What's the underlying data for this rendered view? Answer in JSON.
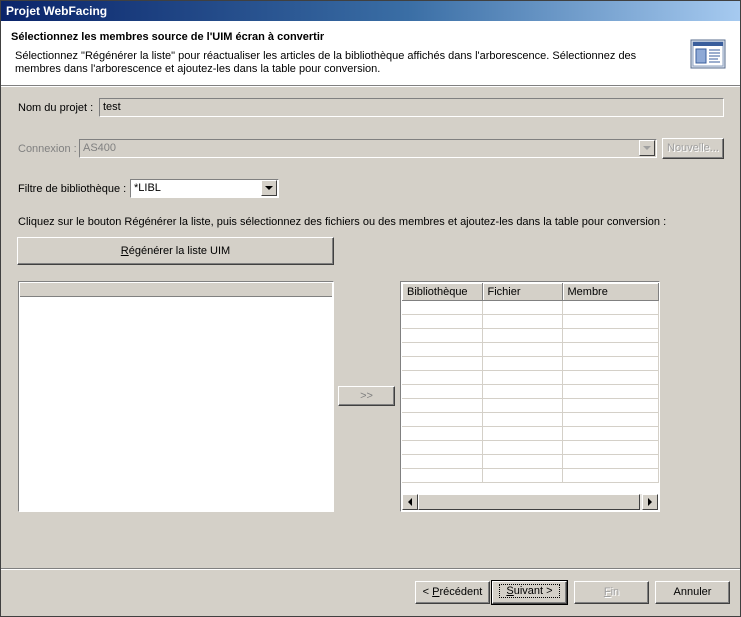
{
  "window": {
    "title": "Projet WebFacing"
  },
  "header": {
    "title": "Sélectionnez les membres source de l'UIM écran à convertir",
    "description": "Sélectionnez \"Régénérer la liste\" pour réactualiser les articles de la bibliothèque affichés dans l'arborescence. Sélectionnez des membres dans l'arborescence et ajoutez-les dans la table pour conversion.",
    "icon": "wizard-banner-icon"
  },
  "project": {
    "label": "Nom du projet :",
    "value": "test"
  },
  "connection": {
    "label": "Connexion :",
    "value": "AS400",
    "new_button": "Nouvelle..."
  },
  "library_filter": {
    "label": "Filtre de bibliothèque :",
    "value": "*LIBL"
  },
  "instruction": "Cliquez sur le bouton Régénérer la liste, puis sélectionnez des fichiers ou des membres et ajoutez-les dans la table pour conversion :",
  "refresh_button": {
    "mnemonic": "R",
    "rest": "égénérer la liste UIM"
  },
  "add_button": ">>",
  "table": {
    "columns": [
      "Bibliothèque",
      "Fichier",
      "Membre"
    ],
    "rows": []
  },
  "footer": {
    "back": {
      "mnemonic": "P",
      "prefix": "< ",
      "rest": "récédent"
    },
    "next": {
      "mnemonic": "S",
      "rest": "uivant >"
    },
    "finish": {
      "mnemonic": "F",
      "rest": "in"
    },
    "cancel": "Annuler"
  }
}
